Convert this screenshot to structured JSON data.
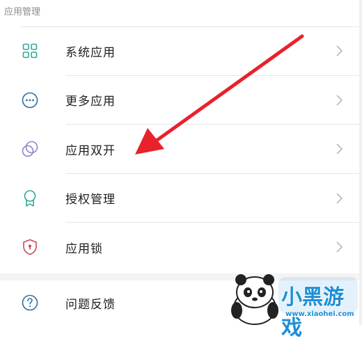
{
  "section": {
    "title": "应用管理"
  },
  "items": [
    {
      "label": "系统应用",
      "icon": "grid-apps-icon"
    },
    {
      "label": "更多应用",
      "icon": "more-dots-icon"
    },
    {
      "label": "应用双开",
      "icon": "dual-circles-icon"
    },
    {
      "label": "授权管理",
      "icon": "badge-ribbon-icon"
    },
    {
      "label": "应用锁",
      "icon": "shield-lock-icon"
    }
  ],
  "bottom_item": {
    "label": "问题反馈",
    "icon": "question-circle-icon"
  },
  "watermark": {
    "brand": "小黑游戏",
    "url": "www.xiaohei.com"
  },
  "colors": {
    "icon_teal": "#2fa79a",
    "icon_purple": "#8a85c7",
    "icon_red": "#c9485a",
    "arrow": "#e8212b"
  }
}
